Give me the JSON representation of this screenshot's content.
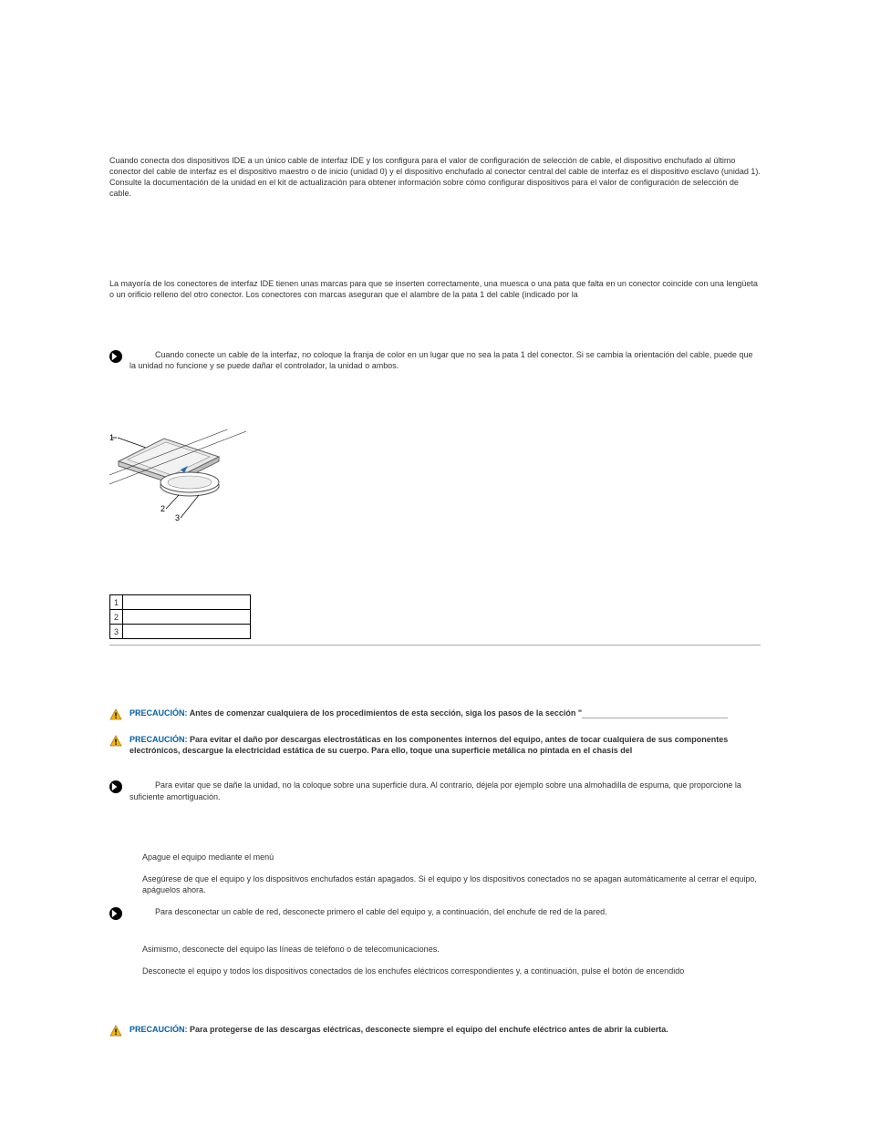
{
  "p1": "Cuando conecta dos dispositivos IDE a un único cable de interfaz IDE y los configura para el valor de configuración de selección de cable, el dispositivo enchufado al último conector del cable de interfaz es el dispositivo maestro o de inicio (unidad 0) y el dispositivo enchufado al conector central del cable de interfaz es el dispositivo esclavo (unidad 1). Consulte la documentación de la unidad en el kit de actualización para obtener información sobre cómo configurar dispositivos para el valor de configuración de selección de cable.",
  "p2": "La mayoría de los conectores de interfaz IDE tienen unas marcas para que se inserten correctamente, una muesca o una pata que falta en un conector coincide con una lengüeta o un orificio relleno del otro conector. Los conectores con marcas aseguran que el alambre de la pata 1 del cable (indicado por la",
  "notice1_lead": "",
  "notice1": "Cuando conecte un cable de la interfaz, no coloque la franja de color en un lugar que no sea la pata 1 del conector. Si se cambia la orientación del cable, puede que la unidad no funcione y se puede dañar el controlador, la unidad o ambos.",
  "key_rows": [
    {
      "n": "1",
      "d": ""
    },
    {
      "n": "2",
      "d": ""
    },
    {
      "n": "3",
      "d": ""
    }
  ],
  "caution_label": "PRECAUCIÓN:",
  "caution1": "Antes de comenzar cualquiera de los procedimientos de esta sección, siga los pasos de la sección \"",
  "caution2": "Para evitar el daño por descargas electrostáticas en los componentes internos del equipo, antes de tocar cualquiera de sus componentes electrónicos, descargue la electricidad estática de su cuerpo. Para ello, toque una superficie metálica no pintada en el chasis del",
  "notice2": "Para evitar que se dañe la unidad, no la coloque sobre una superficie dura. Al contrario, déjela por ejemplo sobre una almohadilla de espuma, que proporcione la suficiente amortiguación.",
  "step1_lbl": "",
  "step1_txt": "Apague el equipo mediante el menú",
  "step2_lbl": "",
  "step2_txt": "Asegúrese de que el equipo y los dispositivos enchufados están apagados. Si el equipo y los dispositivos conectados no se apagan automáticamente al cerrar el equipo, apáguelos ahora.",
  "notice3": "Para desconectar un cable de red, desconecte primero el cable del equipo y, a continuación, del enchufe de red de la pared.",
  "step3_lbl": "",
  "step3_txt": "Asimismo, desconecte del equipo las líneas de teléfono o de telecomunicaciones.",
  "step4_lbl": "",
  "step4_txt": "Desconecte el equipo y todos los dispositivos conectados de los enchufes eléctricos correspondientes y, a continuación, pulse el botón de encendido",
  "caution3": "Para protegerse de las descargas eléctricas, desconecte siempre el equipo del enchufe eléctrico antes de abrir la cubierta."
}
